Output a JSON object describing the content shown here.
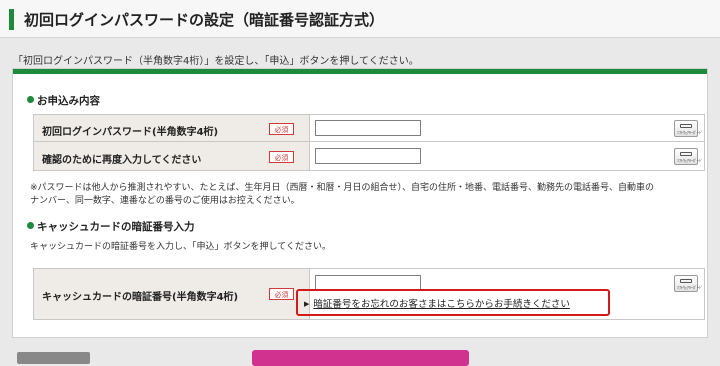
{
  "page": {
    "title": "初回ログインパスワードの設定（暗証番号認証方式）",
    "intro": "「初回ログインパスワード（半角数字4桁）」を設定し、「申込」ボタンを押してください。"
  },
  "section1": {
    "heading": "お申込み内容",
    "rows": [
      {
        "label": "初回ログインパスワード(半角数字4桁)",
        "required": "必須",
        "value": ""
      },
      {
        "label": "確認のために再度入力してください",
        "required": "必須",
        "value": ""
      }
    ],
    "note_line1": "※パスワードは他人から推測されやすい、たとえば、生年月日（西暦・和暦・月日の組合せ）、自宅の住所・地番、電話番号、勤務先の電話番号、自動車の",
    "note_line2": "ナンバー、同一数字、連番などの番号のご使用はお控えください。"
  },
  "section2": {
    "heading": "キャッシュカードの暗証番号入力",
    "description": "キャッシュカードの暗証番号を入力し、「申込」ボタンを押してください。",
    "row": {
      "label": "キャッシュカードの暗証番号(半角数字4桁)",
      "required": "必須",
      "value": ""
    },
    "forgot_link": "暗証番号をお忘れのお客さまはこちらからお手続きください"
  },
  "keyboard_button": {
    "label": "ｿﾌﾄｳｪｱｷｰﾎﾞｰﾄﾞ",
    "icon": "keyboard-icon"
  },
  "colors": {
    "accent": "#1d8a3c",
    "required": "#d03a3a",
    "highlight": "#d31a1a",
    "apply_button": "#d1318f",
    "label_bg": "#efebe6"
  }
}
